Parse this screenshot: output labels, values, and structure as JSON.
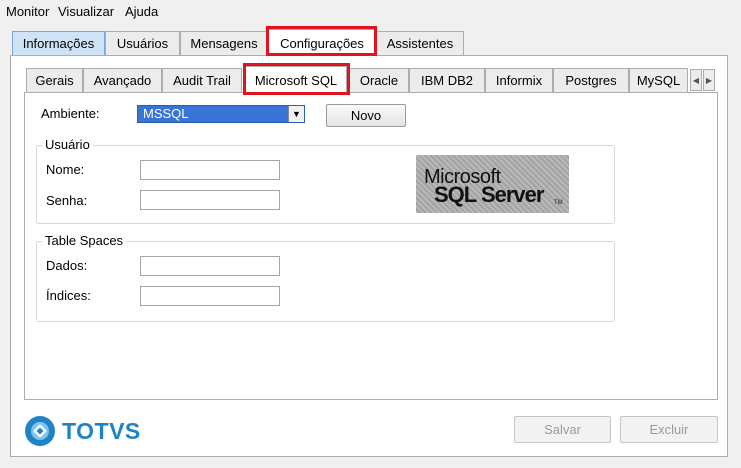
{
  "menu": [
    "Monitor",
    "Visualizar",
    "Ajuda"
  ],
  "tabs": [
    "Informações",
    "Usuários",
    "Mensagens",
    "Configurações",
    "Assistentes"
  ],
  "inner_tabs": [
    "Gerais",
    "Avançado",
    "Audit Trail",
    "Microsoft SQL",
    "Oracle",
    "IBM DB2",
    "Informix",
    "Postgres",
    "MySQL"
  ],
  "ambiente": {
    "label": "Ambiente:",
    "value": "MSSQL",
    "new_label": "Novo"
  },
  "usuario_group": {
    "title": "Usuário",
    "nome_label": "Nome:",
    "nome_value": "",
    "senha_label": "Senha:",
    "senha_value": ""
  },
  "tablespaces_group": {
    "title": "Table Spaces",
    "dados_label": "Dados:",
    "dados_value": "",
    "indices_label": "Índices:",
    "indices_value": ""
  },
  "sqlserver_logo": {
    "line1": "Microsoft",
    "line2": "SQL Server",
    "tm": "TM"
  },
  "footer": {
    "brand": "TOTVS",
    "save_label": "Salvar",
    "delete_label": "Excluir"
  },
  "colors": {
    "highlight": "#e0141e",
    "selection": "#3875d7",
    "brand": "#1e84c6"
  },
  "icons": {
    "scroll_left": "chevron-left-icon",
    "scroll_right": "chevron-right-icon",
    "dropdown": "chevron-down-icon"
  }
}
